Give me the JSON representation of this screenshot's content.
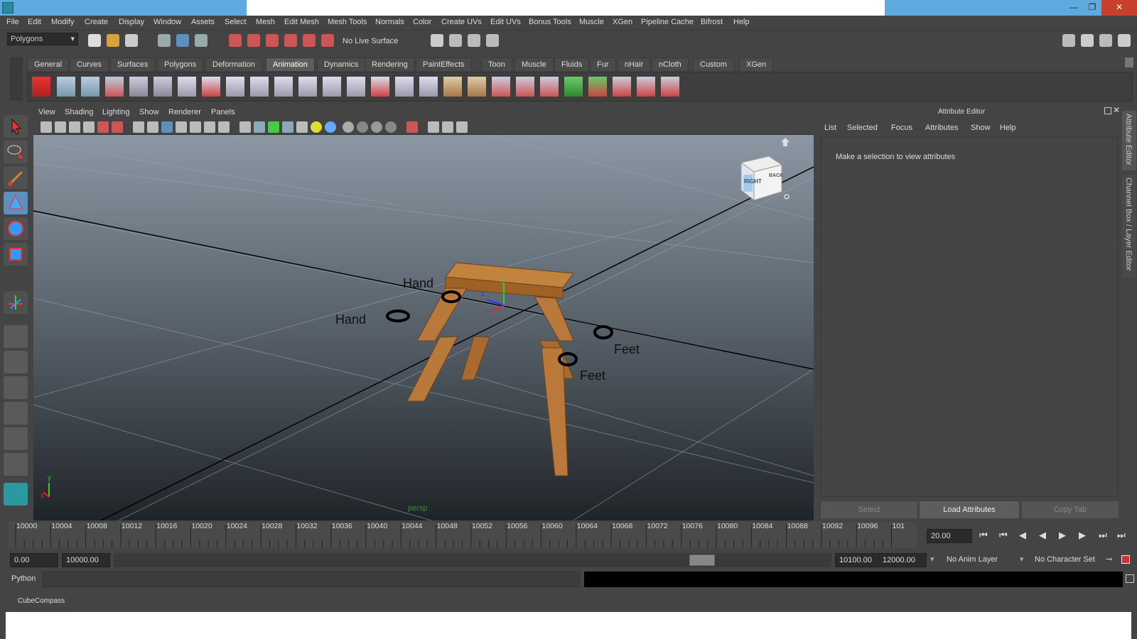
{
  "menubar": [
    "File",
    "Edit",
    "Modify",
    "Create",
    "Display",
    "Window",
    "Assets",
    "Select",
    "Mesh",
    "Edit Mesh",
    "Mesh Tools",
    "Normals",
    "Color",
    "Create UVs",
    "Edit UVs",
    "Bonus Tools",
    "Muscle",
    "XGen",
    "Pipeline Cache",
    "Bifrost",
    "Help"
  ],
  "status_line": {
    "mode": "Polygons",
    "live_surface": "No Live Surface"
  },
  "shelf_tabs": [
    "General",
    "Curves",
    "Surfaces",
    "Polygons",
    "Deformation",
    "Animation",
    "Dynamics",
    "Rendering",
    "PaintEffects",
    "Toon",
    "Muscle",
    "Fluids",
    "Fur",
    "nHair",
    "nCloth",
    "Custom",
    "XGen"
  ],
  "active_shelf_tab": "Animation",
  "panel_menu": [
    "View",
    "Shading",
    "Lighting",
    "Show",
    "Renderer",
    "Panels"
  ],
  "viewport": {
    "camera": "persp",
    "labels": {
      "hand_1": "Hand",
      "hand_2": "Hand",
      "feet_1": "Feet",
      "feet_2": "Feet"
    },
    "viewcube": {
      "right": "RIGHT",
      "back": "BACK"
    },
    "axis": {
      "x": "x",
      "y": "y",
      "z": "z"
    }
  },
  "attribute_editor": {
    "title": "Attribute Editor",
    "menu": [
      "List",
      "Selected",
      "Focus",
      "Attributes",
      "Show",
      "Help"
    ],
    "message": "Make a selection to view attributes",
    "buttons": {
      "select": "Select",
      "load": "Load Attributes",
      "copy": "Copy Tab"
    }
  },
  "side_tabs": {
    "attr": "Attribute Editor",
    "channel": "Channel Box / Layer Editor"
  },
  "timeline": {
    "ticks": [
      "10000",
      "10004",
      "10008",
      "10012",
      "10016",
      "10020",
      "10024",
      "10028",
      "10032",
      "10036",
      "10040",
      "10044",
      "10048",
      "10052",
      "10056",
      "10060",
      "10064",
      "10068",
      "10072",
      "10076",
      "10080",
      "10084",
      "10088",
      "10092",
      "10096",
      "101"
    ],
    "current_frame": "20.00"
  },
  "range": {
    "start": "0.00",
    "anim_start": "10000.00",
    "anim_end": "10100.00",
    "end": "12000.00",
    "anim_layer": "No Anim Layer",
    "char_set": "No Character Set"
  },
  "command_line": {
    "lang": "Python"
  },
  "help_line": "CubeCompass",
  "colors": {
    "accent": "#5d8fbf",
    "title_bar": "#5ea9dd",
    "close": "#c7402e",
    "wood": "#b8793a"
  }
}
